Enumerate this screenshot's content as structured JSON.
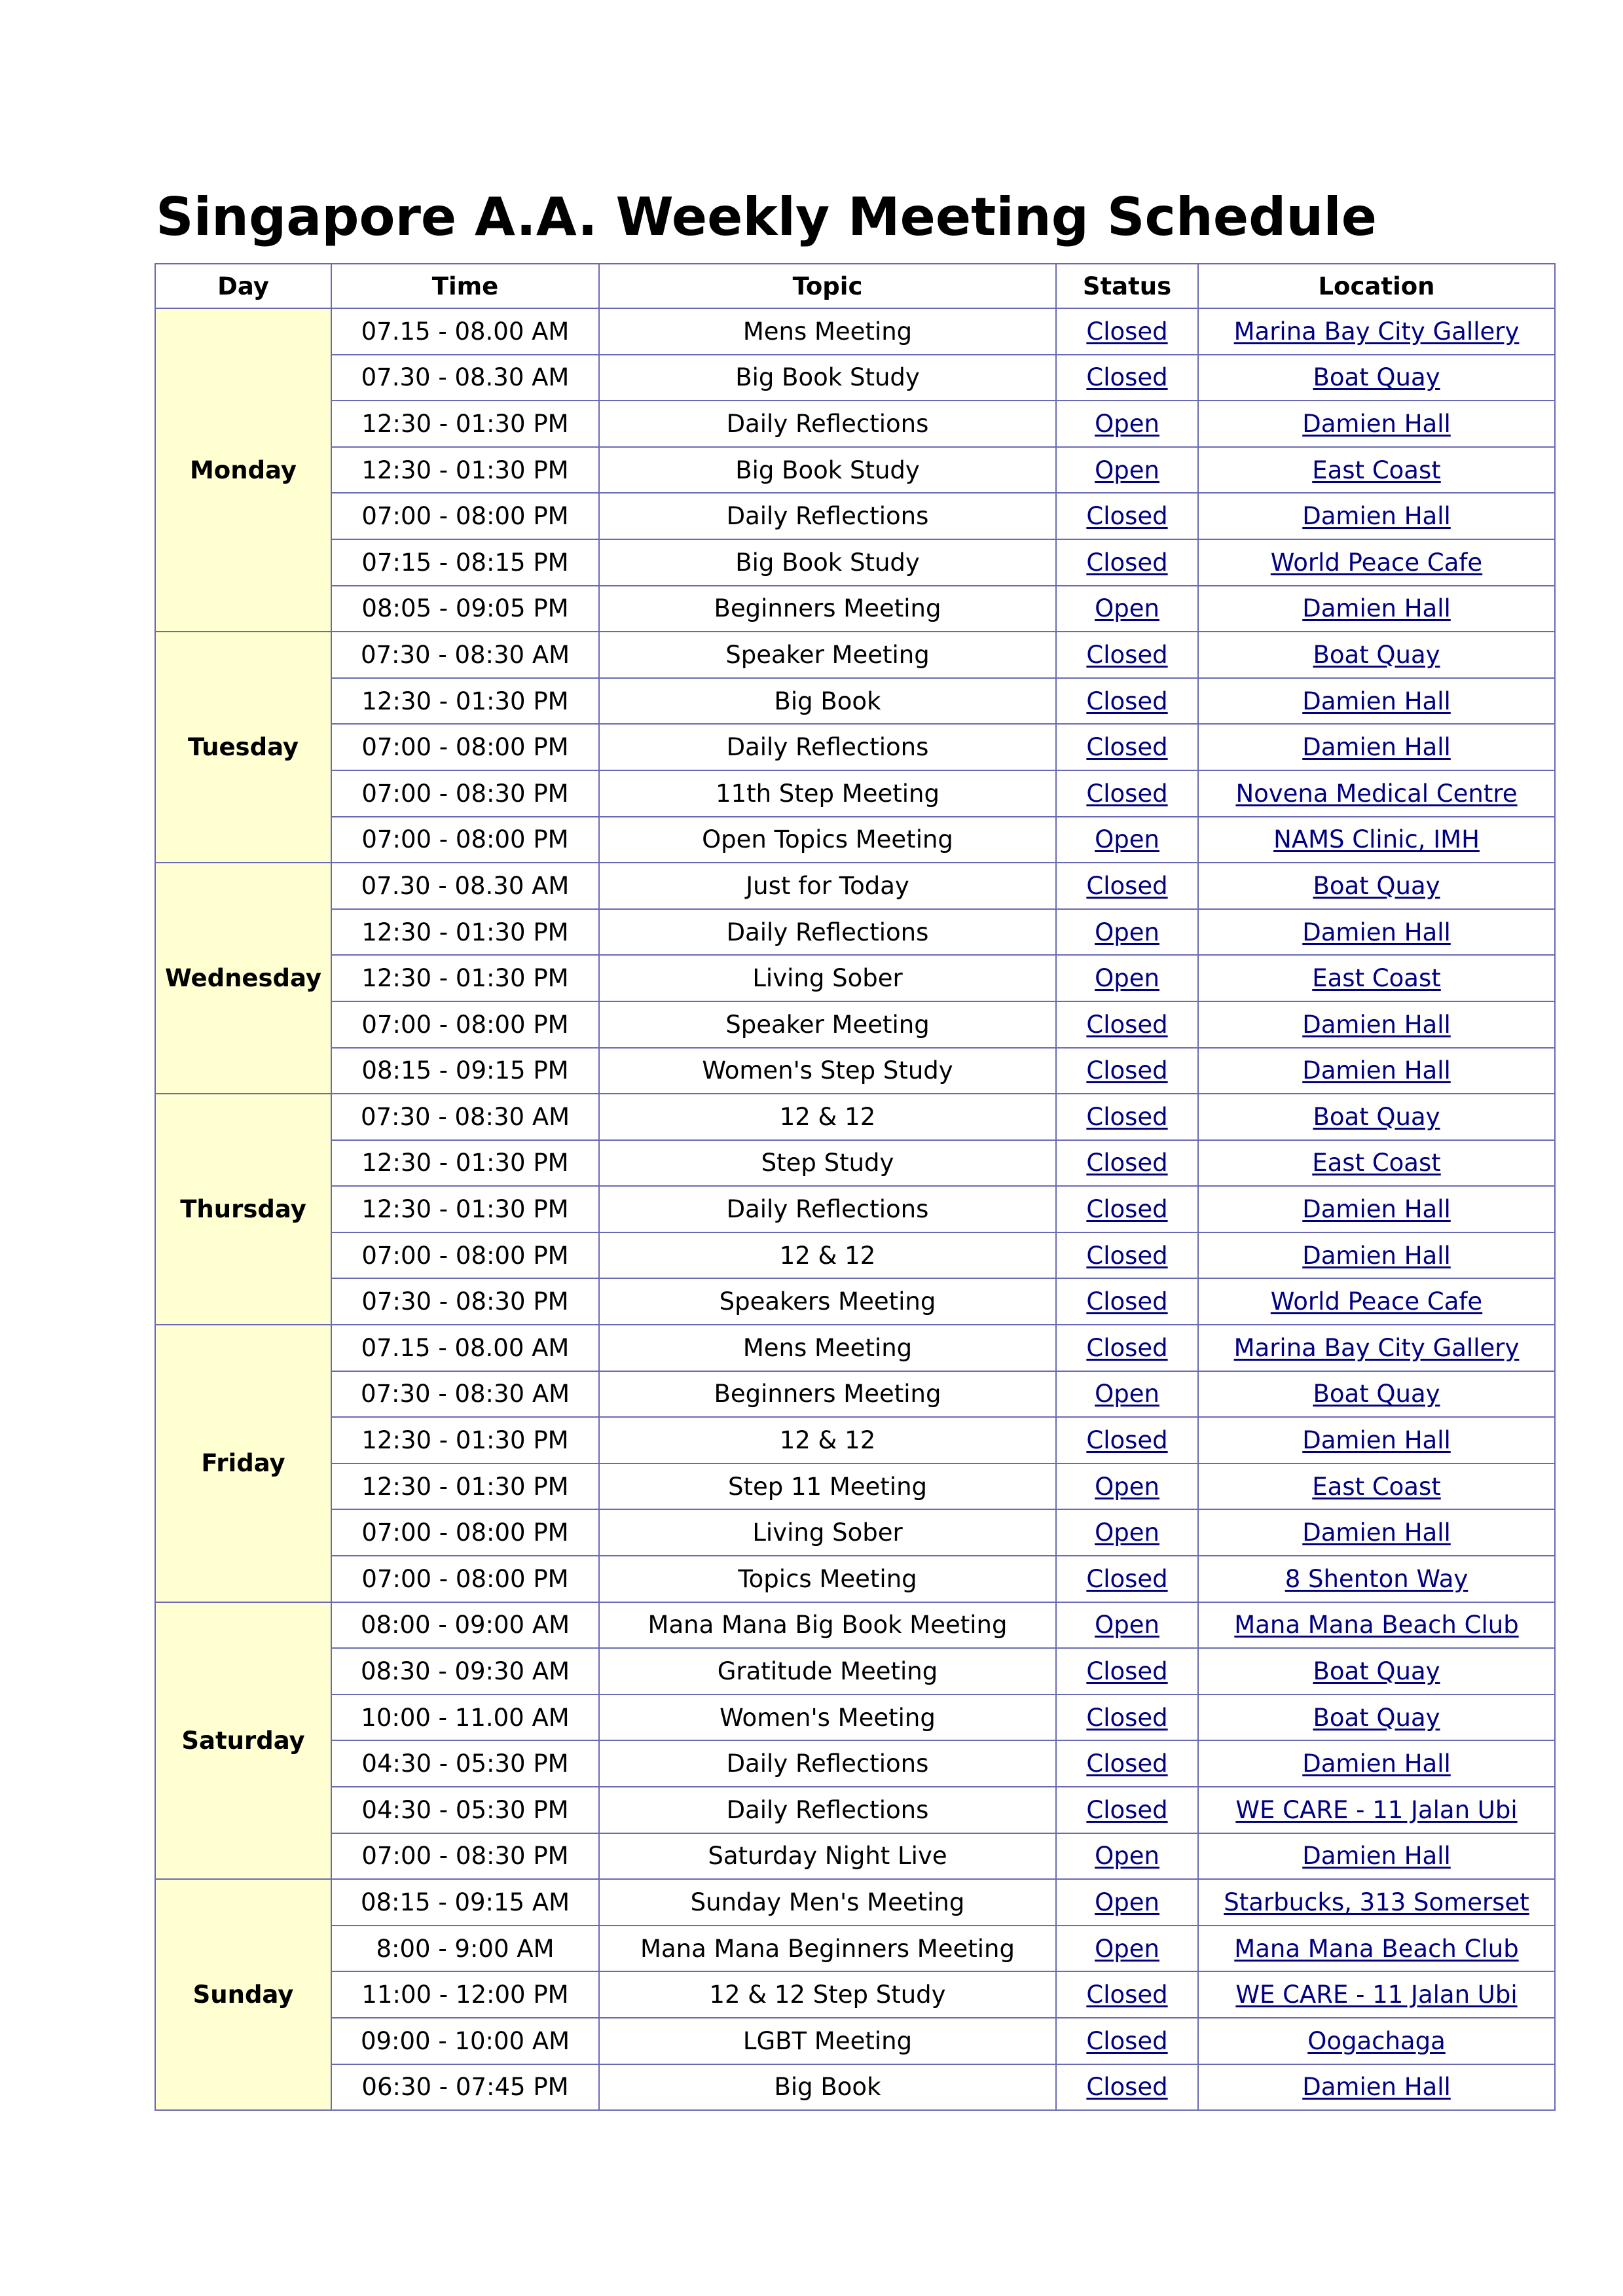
{
  "title": "Singapore A.A. Weekly Meeting Schedule",
  "columns": [
    "Day",
    "Time",
    "Topic",
    "Status",
    "Location"
  ],
  "colors": {
    "day_fill": "#ffffd2",
    "border": "#6a6ab4",
    "link": "#000080"
  },
  "days": [
    {
      "day": "Monday",
      "meetings": [
        {
          "time": "07.15 - 08.00 AM",
          "topic": "Mens Meeting",
          "status": "Closed",
          "location": "Marina Bay City Gallery"
        },
        {
          "time": "07.30 - 08.30 AM",
          "topic": "Big Book Study",
          "status": "Closed",
          "location": "Boat Quay"
        },
        {
          "time": "12:30 - 01:30 PM",
          "topic": "Daily Reflections",
          "status": "Open",
          "location": "Damien Hall"
        },
        {
          "time": "12:30 - 01:30 PM",
          "topic": "Big Book Study",
          "status": "Open",
          "location": "East Coast"
        },
        {
          "time": "07:00 - 08:00 PM",
          "topic": "Daily Reflections",
          "status": "Closed",
          "location": "Damien Hall"
        },
        {
          "time": "07:15 - 08:15 PM",
          "topic": "Big Book Study",
          "status": "Closed",
          "location": "World Peace Cafe"
        },
        {
          "time": "08:05 - 09:05 PM",
          "topic": "Beginners Meeting",
          "status": "Open",
          "location": "Damien Hall"
        }
      ]
    },
    {
      "day": "Tuesday",
      "meetings": [
        {
          "time": "07:30 - 08:30 AM",
          "topic": "Speaker Meeting",
          "status": "Closed",
          "location": "Boat Quay"
        },
        {
          "time": "12:30 - 01:30 PM",
          "topic": "Big Book",
          "status": "Closed",
          "location": "Damien Hall"
        },
        {
          "time": "07:00 - 08:00 PM",
          "topic": "Daily Reflections",
          "status": "Closed",
          "location": "Damien Hall"
        },
        {
          "time": "07:00 - 08:30 PM",
          "topic": "11th Step Meeting",
          "status": "Closed",
          "location": "Novena Medical Centre"
        },
        {
          "time": "07:00 - 08:00 PM",
          "topic": "Open Topics Meeting",
          "status": "Open",
          "location": "NAMS Clinic, IMH"
        }
      ]
    },
    {
      "day": "Wednesday",
      "meetings": [
        {
          "time": "07.30 - 08.30 AM",
          "topic": "Just for Today",
          "status": "Closed",
          "location": "Boat Quay"
        },
        {
          "time": "12:30 - 01:30 PM",
          "topic": "Daily Reflections",
          "status": "Open",
          "location": "Damien Hall"
        },
        {
          "time": "12:30 - 01:30 PM",
          "topic": "Living Sober",
          "status": "Open",
          "location": "East Coast"
        },
        {
          "time": "07:00 - 08:00 PM",
          "topic": "Speaker Meeting",
          "status": "Closed",
          "location": "Damien Hall"
        },
        {
          "time": "08:15 - 09:15 PM",
          "topic": "Women's Step Study",
          "status": "Closed",
          "location": "Damien Hall"
        }
      ]
    },
    {
      "day": "Thursday",
      "meetings": [
        {
          "time": "07:30 - 08:30 AM",
          "topic": "12 & 12",
          "status": "Closed",
          "location": "Boat Quay"
        },
        {
          "time": "12:30 - 01:30 PM",
          "topic": "Step Study",
          "status": "Closed",
          "location": "East Coast"
        },
        {
          "time": "12:30 - 01:30 PM",
          "topic": "Daily Reflections",
          "status": "Closed",
          "location": "Damien Hall"
        },
        {
          "time": "07:00 - 08:00 PM",
          "topic": "12 & 12",
          "status": "Closed",
          "location": "Damien Hall"
        },
        {
          "time": "07:30 - 08:30 PM",
          "topic": "Speakers Meeting",
          "status": "Closed",
          "location": "World Peace Cafe"
        }
      ]
    },
    {
      "day": "Friday",
      "meetings": [
        {
          "time": "07.15 - 08.00 AM",
          "topic": "Mens Meeting",
          "status": "Closed",
          "location": "Marina Bay City Gallery"
        },
        {
          "time": "07:30 - 08:30 AM",
          "topic": "Beginners Meeting",
          "status": "Open",
          "location": "Boat Quay"
        },
        {
          "time": "12:30 - 01:30 PM",
          "topic": "12 & 12",
          "status": "Closed",
          "location": "Damien Hall"
        },
        {
          "time": "12:30 - 01:30 PM",
          "topic": "Step 11 Meeting",
          "status": "Open",
          "location": "East Coast"
        },
        {
          "time": "07:00 - 08:00 PM",
          "topic": "Living Sober",
          "status": "Open",
          "location": "Damien Hall"
        },
        {
          "time": "07:00 - 08:00 PM",
          "topic": "Topics Meeting",
          "status": "Closed",
          "location": "8 Shenton Way"
        }
      ]
    },
    {
      "day": "Saturday",
      "meetings": [
        {
          "time": "08:00 - 09:00 AM",
          "topic": "Mana Mana Big Book Meeting",
          "status": "Open",
          "location": "Mana Mana Beach Club"
        },
        {
          "time": "08:30 - 09:30 AM",
          "topic": "Gratitude Meeting",
          "status": "Closed",
          "location": "Boat Quay"
        },
        {
          "time": "10:00 - 11.00 AM",
          "topic": "Women's Meeting",
          "status": "Closed",
          "location": "Boat Quay"
        },
        {
          "time": "04:30 - 05:30 PM",
          "topic": "Daily Reflections",
          "status": "Closed",
          "location": "Damien Hall"
        },
        {
          "time": "04:30 - 05:30 PM",
          "topic": "Daily Reflections",
          "status": "Closed",
          "location": "WE CARE - 11 Jalan Ubi"
        },
        {
          "time": "07:00 - 08:30 PM",
          "topic": "Saturday Night Live",
          "status": "Open",
          "location": "Damien Hall"
        }
      ]
    },
    {
      "day": "Sunday",
      "meetings": [
        {
          "time": "08:15 - 09:15 AM",
          "topic": "Sunday Men's Meeting",
          "status": "Open",
          "location": "Starbucks, 313 Somerset"
        },
        {
          "time": "8:00 - 9:00 AM",
          "topic": "Mana Mana Beginners Meeting",
          "status": "Open",
          "location": "Mana Mana Beach Club"
        },
        {
          "time": "11:00 - 12:00 PM",
          "topic": "12 & 12 Step Study",
          "status": "Closed",
          "location": "WE CARE - 11 Jalan Ubi"
        },
        {
          "time": "09:00 - 10:00 AM",
          "topic": "LGBT Meeting",
          "status": "Closed",
          "location": "Oogachaga"
        },
        {
          "time": "06:30 - 07:45 PM",
          "topic": "Big Book",
          "status": "Closed",
          "location": "Damien Hall"
        }
      ]
    }
  ]
}
